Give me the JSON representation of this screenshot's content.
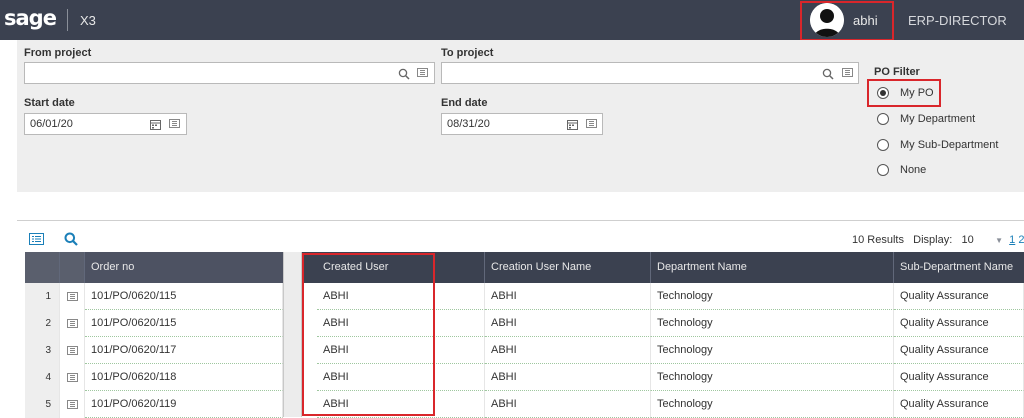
{
  "topbar": {
    "logo": "sage",
    "app": "X3",
    "user": "abhi",
    "role": "ERP-DIRECTOR"
  },
  "criteria": {
    "from_project_label": "From project",
    "from_project_value": "",
    "to_project_label": "To project",
    "to_project_value": "",
    "start_date_label": "Start date",
    "start_date_value": "06/01/20",
    "end_date_label": "End date",
    "end_date_value": "08/31/20",
    "po_filter": {
      "title": "PO Filter",
      "options": [
        "My PO",
        "My Department",
        "My Sub-Department",
        "None"
      ],
      "selected": "My PO"
    }
  },
  "results": {
    "count_text": "10 Results",
    "display_label": "Display:",
    "display_value": "10",
    "pages": [
      "1",
      "2"
    ],
    "columns": [
      "Order no",
      "Created User",
      "Creation User Name",
      "Department Name",
      "Sub-Department Name"
    ],
    "rows": [
      {
        "num": "1",
        "order_no": "101/PO/0620/115",
        "created_user": "ABHI",
        "creation_user_name": "ABHI",
        "department": "Technology",
        "sub_department": "Quality Assurance"
      },
      {
        "num": "2",
        "order_no": "101/PO/0620/115",
        "created_user": "ABHI",
        "creation_user_name": "ABHI",
        "department": "Technology",
        "sub_department": "Quality Assurance"
      },
      {
        "num": "3",
        "order_no": "101/PO/0620/117",
        "created_user": "ABHI",
        "creation_user_name": "ABHI",
        "department": "Technology",
        "sub_department": "Quality Assurance"
      },
      {
        "num": "4",
        "order_no": "101/PO/0620/118",
        "created_user": "ABHI",
        "creation_user_name": "ABHI",
        "department": "Technology",
        "sub_department": "Quality Assurance"
      },
      {
        "num": "5",
        "order_no": "101/PO/0620/119",
        "created_user": "ABHI",
        "creation_user_name": "ABHI",
        "department": "Technology",
        "sub_department": "Quality Assurance"
      }
    ]
  },
  "colors": {
    "topbar": "#3b4150",
    "highlight": "#d9262b",
    "link": "#1a7fb8"
  }
}
